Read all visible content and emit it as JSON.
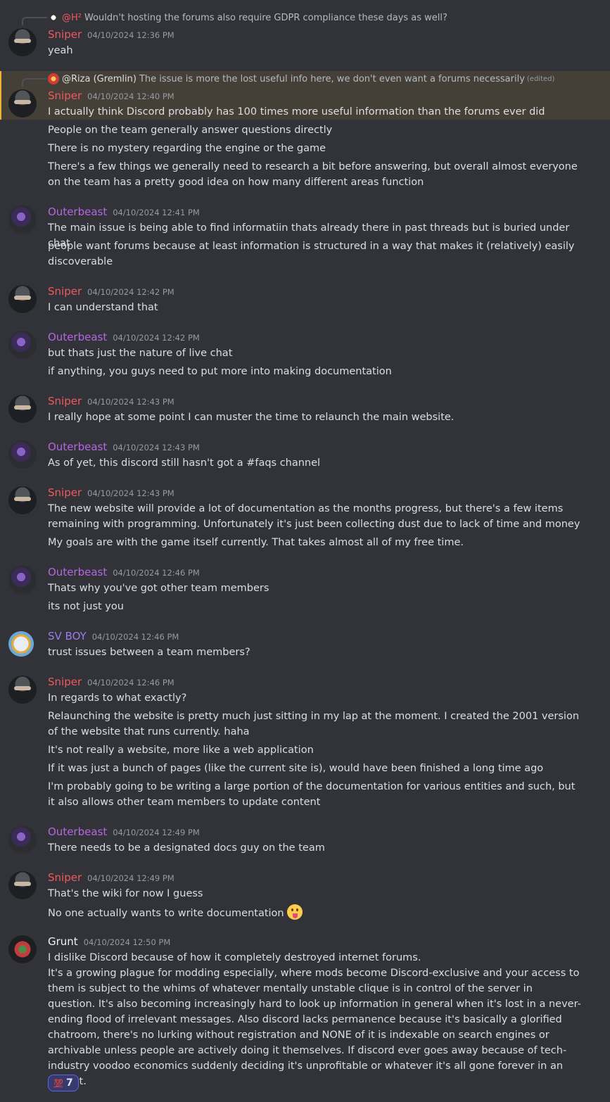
{
  "colors": {
    "background": "#313338",
    "highlight_bg": "#444038",
    "highlight_bar": "#f0b232",
    "text": "#dbdee1",
    "muted": "#949ba4",
    "sniper": "#f0595e",
    "outerbeast": "#b667e0",
    "svboy": "#9b7be8",
    "grunt": "#f2f3f5",
    "reaction_border": "#5865f2"
  },
  "messages": [
    {
      "reply": {
        "icon": "ping-pong-avatar-icon",
        "name": "@H²",
        "text": "Wouldn't hosting the forums also require GDPR compliance these days as well?"
      },
      "author": "Sniper",
      "timestamp": "04/10/2024 12:36 PM",
      "lines": [
        "yeah"
      ]
    },
    {
      "highlighted": true,
      "reply": {
        "icon": "riza-avatar-icon",
        "name": "@Riza (Gremlin)",
        "text": "The issue is more the lost useful info here, we don't even want a forums necessarily",
        "edited": "(edited)"
      },
      "author": "Sniper",
      "timestamp": "04/10/2024 12:40 PM",
      "lines": [
        "I actually think Discord probably has 100 times more useful information than the forums ever did"
      ]
    },
    {
      "continuation": true,
      "lines": [
        "People on the team generally answer questions directly",
        "There is no mystery regarding the engine or the game",
        "There's a few things we generally need to research a bit before answering, but overall almost everyone on the team has a pretty good idea on how many different areas function"
      ]
    },
    {
      "author": "Outerbeast",
      "timestamp": "04/10/2024 12:41 PM",
      "lines": [
        "The main issue is being able to find informatiin thats already there in past threads but is buried under chat",
        "people want forums because at least information is structured in a way that makes it (relatively) easily discoverable"
      ]
    },
    {
      "author": "Sniper",
      "timestamp": "04/10/2024 12:42 PM",
      "lines": [
        "I can understand that"
      ]
    },
    {
      "author": "Outerbeast",
      "timestamp": "04/10/2024 12:42 PM",
      "lines": [
        "but thats just the nature of live chat",
        "if anything, you guys need to put more into making documentation"
      ]
    },
    {
      "author": "Sniper",
      "timestamp": "04/10/2024 12:43 PM",
      "lines": [
        "I really hope at some point I can muster the time to relaunch the main website."
      ]
    },
    {
      "author": "Outerbeast",
      "timestamp": "04/10/2024 12:43 PM",
      "lines": [
        "As of yet, this discord still hasn't got a #faqs channel"
      ]
    },
    {
      "author": "Sniper",
      "timestamp": "04/10/2024 12:43 PM",
      "lines": [
        "The new website will provide a lot of documentation as the months progress, but there's a few items remaining with programming. Unfortunately it's just been collecting dust due to lack of time and money",
        "My goals are with the game itself currently. That takes almost all of my free time."
      ]
    },
    {
      "author": "Outerbeast",
      "timestamp": "04/10/2024 12:46 PM",
      "lines": [
        "Thats why you've got other team members",
        "its not just you"
      ]
    },
    {
      "author": "SV BOY",
      "timestamp": "04/10/2024 12:46 PM",
      "lines": [
        "trust issues between a team members?"
      ]
    },
    {
      "author": "Sniper",
      "timestamp": "04/10/2024 12:46 PM",
      "lines": [
        "In regards to what exactly?",
        "Relaunching the website is pretty much just sitting in my lap at the moment. I created the 2001 version of the website that runs currently. haha",
        "It's not really a website, more like a web application",
        "If it was just a bunch of pages (like the current site is), would have been finished a long time ago",
        "I'm probably going to be writing a large portion of the documentation for various entities and such, but it also allows other team members to update content"
      ]
    },
    {
      "author": "Outerbeast",
      "timestamp": "04/10/2024 12:49 PM",
      "lines": [
        "There needs to be a designated docs guy on the team"
      ]
    },
    {
      "author": "Sniper",
      "timestamp": "04/10/2024 12:49 PM",
      "lines": [
        "That's the wiki for now I guess",
        "No one actually wants to write documentation"
      ]
    },
    {
      "author": "Grunt",
      "timestamp": "04/10/2024 12:50 PM",
      "lines": [
        "I dislike Discord because of how it completely destroyed internet forums.",
        "It's a growing plague for modding especially, where mods become Discord-exclusive and your access to them is subject to the whims of whatever mentally unstable clique is in control of the server in question. It's also becoming increasingly hard to look up information in general when it's lost in a never-ending flood of irrelevant messages. Also discord lacks permanence because it's basically a glorified chatroom, there's no lurking without registration and NONE of it is indexable on search engines or archivable unless people are actively doing it themselves. If discord ever goes away because of tech-industry voodoo economics suddenly deciding it's unprofitable or whatever it's all gone forever in an instant."
      ],
      "reaction": {
        "emoji": "💯",
        "icon": "hundred-points-icon",
        "count": "7"
      }
    }
  ]
}
